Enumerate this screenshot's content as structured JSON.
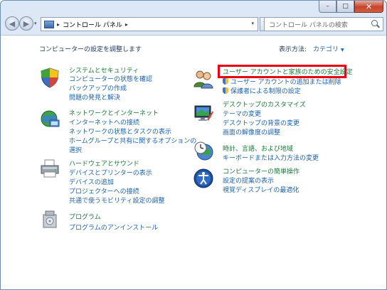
{
  "window": {
    "caption": {
      "minimize": "–",
      "maximize": "□",
      "close": "✕"
    }
  },
  "address": {
    "back_icon": "arrow-left-icon",
    "forward_icon": "arrow-right-icon",
    "separator": "▸",
    "path": "コントロール パネル",
    "trailing_separator": "▸",
    "dropdown": "▾",
    "refresh": "↻",
    "search_placeholder": "コントロール パネルの検索"
  },
  "content": {
    "heading": "コンピューターの設定を調整します",
    "view_label": "表示方法:",
    "view_value": "カテゴリ",
    "view_arrow": "▼"
  },
  "left_categories": [
    {
      "title": "システムとセキュリティ",
      "links": [
        "コンピューターの状態を確認",
        "バックアップの作成",
        "問題の発見と解決"
      ]
    },
    {
      "title": "ネットワークとインターネット",
      "links": [
        "インターネットへの接続",
        "ネットワークの状態とタスクの表示",
        "ホームグループと共有に関するオプションの",
        "選択"
      ]
    },
    {
      "title": "ハードウェアとサウンド",
      "links": [
        "デバイスとプリンターの表示",
        "デバイスの追加",
        "プロジェクターへの接続",
        "共通で使うモビリティ設定の調整"
      ]
    },
    {
      "title": "プログラム",
      "links": [
        "プログラムのアンインストール"
      ]
    }
  ],
  "right_categories": [
    {
      "title": "ユーザー アカウントと家族のための安全設定",
      "links": [
        "ユーザー アカウントの追加または削除",
        "保護者による制限の設定"
      ]
    },
    {
      "title": "デスクトップのカスタマイズ",
      "links": [
        "テーマの変更",
        "デスクトップの背景の変更",
        "画面の解像度の調整"
      ]
    },
    {
      "title": "時計、言語、および地域",
      "links": [
        "キーボードまたは入力方法の変更"
      ]
    },
    {
      "title": "コンピューターの簡単操作",
      "links": [
        "設定の提案の表示",
        "視覚ディスプレイの最適化"
      ]
    }
  ],
  "icons": {
    "system": "shield-icon",
    "network": "globe-network-icon",
    "hardware": "printer-icon",
    "programs": "programs-box-icon",
    "users": "users-icon",
    "desktop": "monitor-icon",
    "clock": "clock-globe-icon",
    "ease": "ease-of-access-icon"
  },
  "colors": {
    "category_title": "#1b7a3a",
    "link": "#1b63b3",
    "highlight_border": "#e60012"
  }
}
